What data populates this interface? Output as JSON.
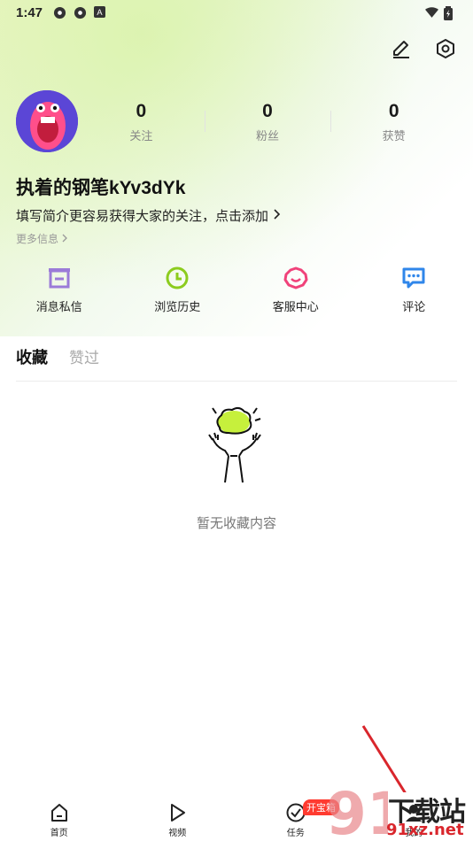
{
  "status_bar": {
    "time": "1:47",
    "icons": [
      "settings-gear-icon",
      "settings-gear-icon",
      "a-notification-icon",
      "wifi-icon",
      "battery-icon"
    ]
  },
  "header": {
    "actions": [
      "edit-icon",
      "settings-icon"
    ]
  },
  "profile": {
    "stats": [
      {
        "value": "0",
        "label": "关注"
      },
      {
        "value": "0",
        "label": "粉丝"
      },
      {
        "value": "0",
        "label": "获赞"
      }
    ],
    "username": "执着的钢笔kYv3dYk",
    "bio": "填写简介更容易获得大家的关注，点击添加",
    "more_info": "更多信息"
  },
  "shortcuts": [
    {
      "label": "消息私信",
      "icon": "inbox-icon",
      "color": "#9b7bd8"
    },
    {
      "label": "浏览历史",
      "icon": "clock-icon",
      "color": "#8ccc1e"
    },
    {
      "label": "客服中心",
      "icon": "service-icon",
      "color": "#f0427a"
    },
    {
      "label": "评论",
      "icon": "comment-icon",
      "color": "#2f86ea"
    }
  ],
  "tabs": {
    "active": "收藏",
    "inactive": "赞过"
  },
  "empty_state": {
    "text": "暂无收藏内容"
  },
  "bottom_nav": {
    "items": [
      {
        "label": "首页",
        "icon": "home-icon"
      },
      {
        "label": "视频",
        "icon": "play-icon"
      },
      {
        "label": "任务",
        "icon": "task-check-icon",
        "badge": "开宝箱"
      },
      {
        "label": "我的",
        "icon": "profile-icon"
      }
    ]
  },
  "watermark": {
    "top": "下载站",
    "bottom": "91xz.net",
    "logo_digits": "91"
  },
  "colors": {
    "accent_green": "#8ccc1e",
    "badge_red": "#ff3b30",
    "avatar_bg": "#5b46d6",
    "arrow_red": "#d9262c"
  }
}
